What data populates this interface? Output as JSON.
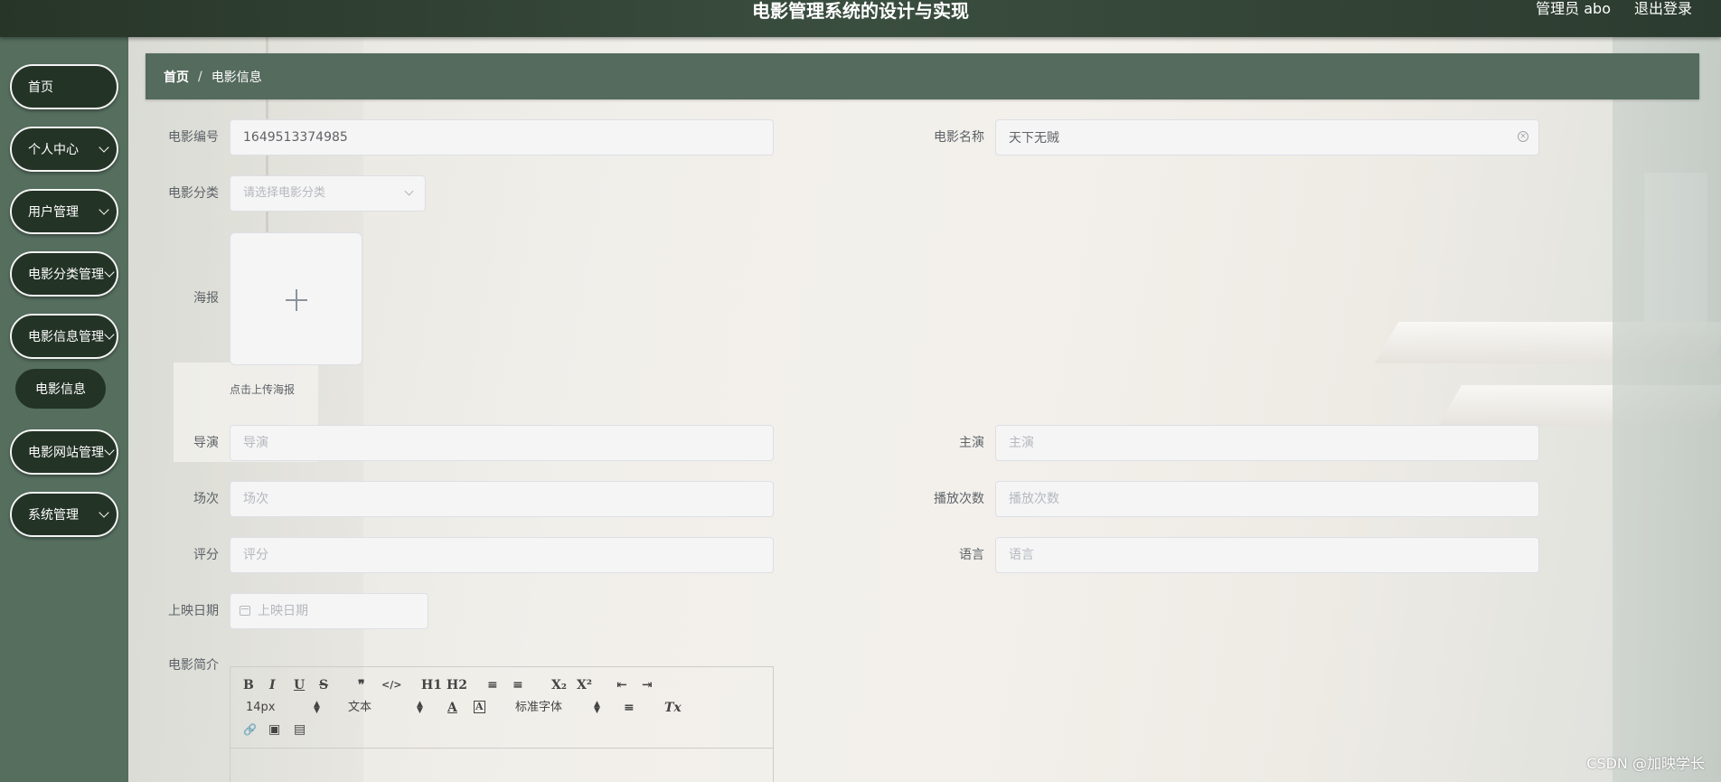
{
  "header": {
    "title": "电影管理系统的设计与实现",
    "user": "管理员 abo",
    "logout": "退出登录"
  },
  "sidebar": {
    "items": [
      {
        "label": "首页",
        "has_arrow": false
      },
      {
        "label": "个人中心",
        "has_arrow": true
      },
      {
        "label": "用户管理",
        "has_arrow": true
      },
      {
        "label": "电影分类管理",
        "has_arrow": true
      },
      {
        "label": "电影信息管理",
        "has_arrow": true
      },
      {
        "label": "电影网站管理",
        "has_arrow": true
      },
      {
        "label": "系统管理",
        "has_arrow": true
      }
    ],
    "submenu": {
      "label": "电影信息"
    }
  },
  "breadcrumb": {
    "home": "首页",
    "separator": "/",
    "current": "电影信息"
  },
  "form": {
    "movie_id": {
      "label": "电影编号",
      "value": "1649513374985"
    },
    "movie_name": {
      "label": "电影名称",
      "value": "天下无贼"
    },
    "category": {
      "label": "电影分类",
      "placeholder": "请选择电影分类"
    },
    "poster": {
      "label": "海报",
      "tip": "点击上传海报"
    },
    "director": {
      "label": "导演",
      "placeholder": "导演"
    },
    "actor": {
      "label": "主演",
      "placeholder": "主演"
    },
    "session": {
      "label": "场次",
      "placeholder": "场次"
    },
    "play_count": {
      "label": "播放次数",
      "placeholder": "播放次数"
    },
    "rating": {
      "label": "评分",
      "placeholder": "评分"
    },
    "language": {
      "label": "语言",
      "placeholder": "语言"
    },
    "release_date": {
      "label": "上映日期",
      "placeholder": "上映日期"
    },
    "intro": {
      "label": "电影简介"
    }
  },
  "editor": {
    "font_size": "14px",
    "paragraph": "文本",
    "font_family": "标准字体",
    "buttons": {
      "bold": "B",
      "italic": "I",
      "underline": "U",
      "strike": "S",
      "quote": "❞",
      "code": "</>",
      "h1": "H1",
      "h2": "H2",
      "ordered_list": "≡",
      "bullet_list": "≡",
      "subscript": "X₂",
      "superscript": "X²",
      "outdent": "⇤",
      "indent": "⇥",
      "color": "A",
      "background": "A",
      "align": "≡",
      "clean": "Tx",
      "link": "🔗",
      "image": "▣",
      "video": "▤"
    }
  },
  "watermark": "CSDN @加映学长",
  "icons": {
    "clear": "circle-close-icon",
    "chevron": "chevron-down-icon",
    "plus": "plus-icon",
    "calendar": "calendar-icon"
  },
  "colors": {
    "header_bg": "#2f4232",
    "sidebar_bg": "#556e5e",
    "menu_item_bg": "#233326",
    "breadcrumb_bg": "#546b5d",
    "input_bg": "#f5f5f5"
  }
}
